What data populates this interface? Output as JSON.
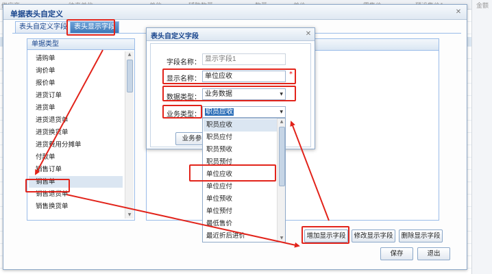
{
  "background": {
    "headers": [
      "供应商",
      "往来单位",
      "单位",
      "辅助数量",
      "数量",
      "单价",
      "零售价",
      "预设售价1",
      "金额"
    ]
  },
  "main_dialog": {
    "title": "单据表头自定义",
    "close_glyph": "✕",
    "tabs": [
      "表头自定义字段",
      "表头显示字段"
    ],
    "active_tab": "表头显示字段",
    "type_panel_title": "单据类型",
    "types": [
      "请购单",
      "询价单",
      "报价单",
      "进货订单",
      "进货单",
      "进货退货单",
      "进货换货单",
      "进货费用分摊单",
      "付款单",
      "销售订单",
      "销售单",
      "销售退货单",
      "销售换货单"
    ],
    "selected_type": "销售单",
    "buttons": {
      "add": "增加显示字段",
      "edit": "修改显示字段",
      "delete": "删除显示字段",
      "save": "保存",
      "exit": "退出"
    }
  },
  "field_dialog": {
    "title": "表头自定义字段",
    "close_glyph": "✕",
    "field_name_label": "字段名称：",
    "field_name_placeholder": "显示字段1",
    "display_name_label": "显示名称：",
    "display_name_value": "单位应收",
    "required_mark": "*",
    "data_type_label": "数据类型：",
    "data_type_value": "业务数据",
    "biz_type_label": "业务类型：",
    "biz_type_value": "职员应收",
    "hidden_button_partial": "业务参"
  },
  "dropdown": {
    "options": [
      "职员应收",
      "职员应付",
      "职员预收",
      "职员预付",
      "单位应收",
      "单位应付",
      "单位预收",
      "单位预付",
      "最低售价",
      "最近折后进价"
    ],
    "highlighted": "单位应收"
  },
  "colors": {
    "accent": "#15428b",
    "highlight_red": "#e2231a",
    "active_tab": "#3d78b8",
    "selection": "#dbe6f2"
  }
}
